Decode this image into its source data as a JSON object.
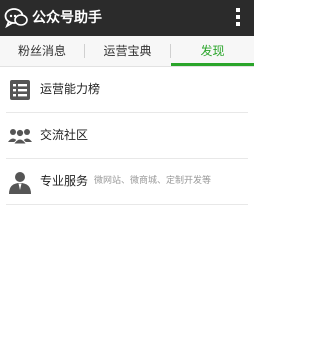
{
  "app": {
    "title": "公众号助手"
  },
  "tabs": [
    {
      "label": "粉丝消息",
      "active": false
    },
    {
      "label": "运营宝典",
      "active": false
    },
    {
      "label": "发现",
      "active": true
    }
  ],
  "list": [
    {
      "label": "运营能力榜",
      "icon": "ranking-list-icon"
    },
    {
      "label": "交流社区",
      "icon": "community-icon"
    },
    {
      "label": "专业服务",
      "icon": "person-icon",
      "subtitle": "微网站、微商城、定制开发等"
    }
  ],
  "colors": {
    "titlebar": "#2b2b2b",
    "accent": "#2aa52a"
  }
}
